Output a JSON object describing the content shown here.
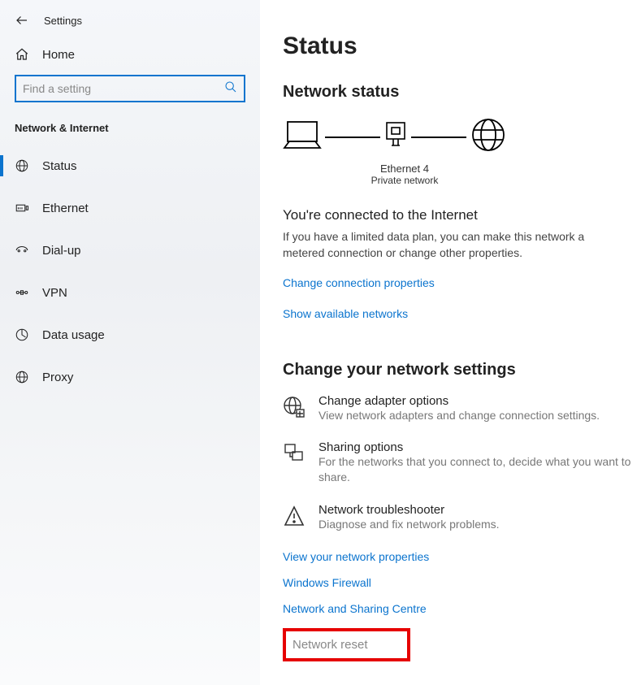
{
  "app": {
    "title": "Settings"
  },
  "sidebar": {
    "home": "Home",
    "search_placeholder": "Find a setting",
    "category": "Network & Internet",
    "items": [
      {
        "label": "Status",
        "icon": "status-icon"
      },
      {
        "label": "Ethernet",
        "icon": "ethernet-icon"
      },
      {
        "label": "Dial-up",
        "icon": "dialup-icon"
      },
      {
        "label": "VPN",
        "icon": "vpn-icon"
      },
      {
        "label": "Data usage",
        "icon": "data-usage-icon"
      },
      {
        "label": "Proxy",
        "icon": "proxy-icon"
      }
    ]
  },
  "main": {
    "title": "Status",
    "network_status_heading": "Network status",
    "diagram": {
      "name": "Ethernet 4",
      "profile": "Private network"
    },
    "connected": {
      "title": "You're connected to the Internet",
      "desc": "If you have a limited data plan, you can make this network a metered connection or change other properties."
    },
    "links": {
      "change_conn_props": "Change connection properties",
      "show_available": "Show available networks"
    },
    "change_heading": "Change your network settings",
    "settings": [
      {
        "title": "Change adapter options",
        "desc": "View network adapters and change connection settings."
      },
      {
        "title": "Sharing options",
        "desc": "For the networks that you connect to, decide what you want to share."
      },
      {
        "title": "Network troubleshooter",
        "desc": "Diagnose and fix network problems."
      }
    ],
    "bottom_links": {
      "view_props": "View your network properties",
      "firewall": "Windows Firewall",
      "sharing_centre": "Network and Sharing Centre",
      "network_reset": "Network reset"
    }
  }
}
